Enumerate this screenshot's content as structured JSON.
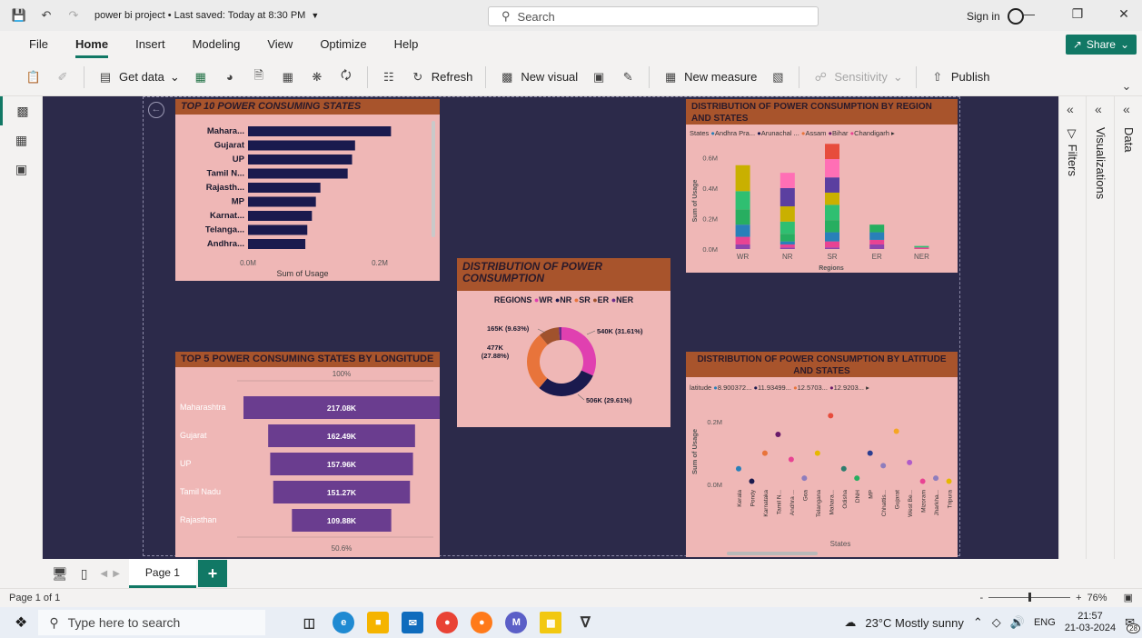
{
  "titlebar": {
    "doc_title": "power bi project • Last saved: Today at 8:30 PM",
    "search_label": "Search",
    "sign_in": "Sign in"
  },
  "menu": {
    "items": [
      "File",
      "Home",
      "Insert",
      "Modeling",
      "View",
      "Optimize",
      "Help"
    ],
    "active": "Home",
    "share": "Share"
  },
  "toolbar": {
    "get_data": "Get data",
    "refresh": "Refresh",
    "new_visual": "New visual",
    "new_measure": "New measure",
    "sensitivity": "Sensitivity",
    "publish": "Publish"
  },
  "panes": {
    "filters": "Filters",
    "visualizations": "Visualizations",
    "data": "Data"
  },
  "top10": {
    "title": "TOP 10 POWER CONSUMING STATES",
    "xlabel": "Sum of Usage",
    "ticks": [
      "0.0M",
      "0.2M"
    ]
  },
  "top5": {
    "title": "TOP 5 POWER CONSUMING STATES BY LONGITUDE",
    "top_pct": "100%",
    "bottom_pct": "50.6%"
  },
  "donut": {
    "title": "DISTRIBUTION OF POWER CONSUMPTION",
    "legend_title": "REGIONS",
    "labels": {
      "wr": "540K (31.61%)",
      "nr": "506K (29.61%)",
      "sr": "477K (27.88%)",
      "er": "165K (9.63%)"
    }
  },
  "region_chart": {
    "title": "DISTRIBUTION OF POWER CONSUMPTION BY REGION AND STATES",
    "legend_title": "States",
    "legend": [
      "Andhra Pra...",
      "Arunachal ...",
      "Assam",
      "Bihar",
      "Chandigarh"
    ],
    "ylabel": "Sum of Usage",
    "xlabel": "Regions",
    "ticks": [
      "0.0M",
      "0.2M",
      "0.4M",
      "0.6M"
    ]
  },
  "lat_chart": {
    "title": "DISTRIBUTION OF POWER CONSUMPTION BY LATITUDE AND STATES",
    "legend_title": "latitude",
    "legend": [
      "8.900372...",
      "11.93499...",
      "12.5703...",
      "12.9203..."
    ],
    "ylabel": "Sum of Usage",
    "xlabel": "States",
    "ticks": [
      "0.0M",
      "0.2M"
    ]
  },
  "pages": {
    "tab": "Page 1"
  },
  "status": {
    "page_of": "Page 1 of 1",
    "zoom": "76%"
  },
  "taskbar": {
    "search": "Type here to search",
    "weather": "23°C  Mostly sunny",
    "lang": "ENG",
    "time": "21:57",
    "date": "21-03-2024",
    "notif": "28"
  },
  "colors": {
    "canvas": "#2c2a4a",
    "visual_bg": "#efb7b6",
    "title_bg": "#a8542c",
    "accent": "#117865",
    "wr": "#e040b0",
    "nr": "#1a1a4e",
    "sr": "#e8743b",
    "er": "#a0522d",
    "ner": "#6a2a8a"
  },
  "chart_data": [
    {
      "type": "bar",
      "orientation": "horizontal",
      "title": "TOP 10 POWER CONSUMING STATES",
      "categories": [
        "Mahara...",
        "Gujarat",
        "UP",
        "Tamil N...",
        "Rajasth...",
        "MP",
        "Karnat...",
        "Telanga...",
        "Andhra..."
      ],
      "values": [
        217.08,
        162.49,
        157.96,
        151.27,
        109.88,
        103,
        97,
        90,
        87
      ],
      "unit": "K",
      "xlabel": "Sum of Usage",
      "xlim": [
        0,
        250
      ],
      "color": "#1a1a4e"
    },
    {
      "type": "bar",
      "orientation": "funnel",
      "title": "TOP 5 POWER CONSUMING STATES BY LONGITUDE",
      "categories": [
        "Maharashtra",
        "Gujarat",
        "UP",
        "Tamil Nadu",
        "Rajasthan"
      ],
      "values": [
        217.08,
        162.49,
        157.96,
        151.27,
        109.88
      ],
      "labels": [
        "217.08K",
        "162.49K",
        "157.96K",
        "151.27K",
        "109.88K"
      ],
      "color": "#6a3d8f"
    },
    {
      "type": "pie",
      "title": "DISTRIBUTION OF POWER CONSUMPTION",
      "categories": [
        "WR",
        "NR",
        "SR",
        "ER",
        "NER"
      ],
      "values": [
        31.61,
        29.61,
        27.88,
        9.63,
        1.27
      ],
      "colors": [
        "#e040b0",
        "#1a1a4e",
        "#e8743b",
        "#a0522d",
        "#6a2a8a"
      ]
    },
    {
      "type": "bar",
      "stacked": true,
      "title": "DISTRIBUTION OF POWER CONSUMPTION BY REGION AND STATES",
      "categories": [
        "WR",
        "NR",
        "SR",
        "ER",
        "NER"
      ],
      "series": [
        {
          "values": [
            0.03,
            0.01,
            0.01,
            0.03,
            0.0
          ],
          "color": "#8e44ad"
        },
        {
          "values": [
            0.05,
            0.02,
            0.04,
            0.03,
            0.01
          ],
          "color": "#e84393"
        },
        {
          "values": [
            0.08,
            0.02,
            0.06,
            0.05,
            0.0
          ],
          "color": "#2980b9"
        },
        {
          "values": [
            0.1,
            0.05,
            0.08,
            0.05,
            0.0
          ],
          "color": "#27ae60"
        },
        {
          "values": [
            0.12,
            0.08,
            0.1,
            0.0,
            0.01
          ],
          "color": "#2fbf71"
        },
        {
          "values": [
            0.17,
            0.1,
            0.08,
            0.0,
            0.0
          ],
          "color": "#c9b000"
        },
        {
          "values": [
            0.0,
            0.12,
            0.1,
            0.0,
            0.0
          ],
          "color": "#5b3fa0"
        },
        {
          "values": [
            0.0,
            0.1,
            0.12,
            0.0,
            0.0
          ],
          "color": "#ff6fb5"
        },
        {
          "values": [
            0.0,
            0.0,
            0.1,
            0.0,
            0.0
          ],
          "color": "#e74c3c"
        }
      ],
      "xlabel": "Regions",
      "ylabel": "Sum of Usage",
      "ylim": [
        0,
        0.65
      ]
    },
    {
      "type": "scatter",
      "title": "DISTRIBUTION OF POWER CONSUMPTION BY LATITUDE AND STATES",
      "categories": [
        "Kerala",
        "Pondy",
        "Karnataka",
        "Tamil N...",
        "Andhra ...",
        "Goa",
        "Telangana",
        "Mahara...",
        "Odisha",
        "DNH",
        "MP",
        "Chhattis...",
        "Gujarat",
        "West Be...",
        "Mizoram",
        "Jharkha...",
        "Tripura"
      ],
      "values": [
        0.05,
        0.01,
        0.1,
        0.16,
        0.08,
        0.02,
        0.1,
        0.22,
        0.05,
        0.02,
        0.1,
        0.06,
        0.17,
        0.07,
        0.01,
        0.02,
        0.01
      ],
      "colors": [
        "#2980b9",
        "#1a1a4e",
        "#e8743b",
        "#6a1a6a",
        "#e84393",
        "#8e7dbd",
        "#e6b800",
        "#e74c3c",
        "#2e7d6e",
        "#27ae60",
        "#2c3e90",
        "#8e7dbd",
        "#f5a623",
        "#b05cc9",
        "#e84393",
        "#8e7dbd",
        "#e6b800"
      ],
      "xlabel": "States",
      "ylabel": "Sum of Usage",
      "ylim": [
        0,
        0.25
      ]
    }
  ]
}
